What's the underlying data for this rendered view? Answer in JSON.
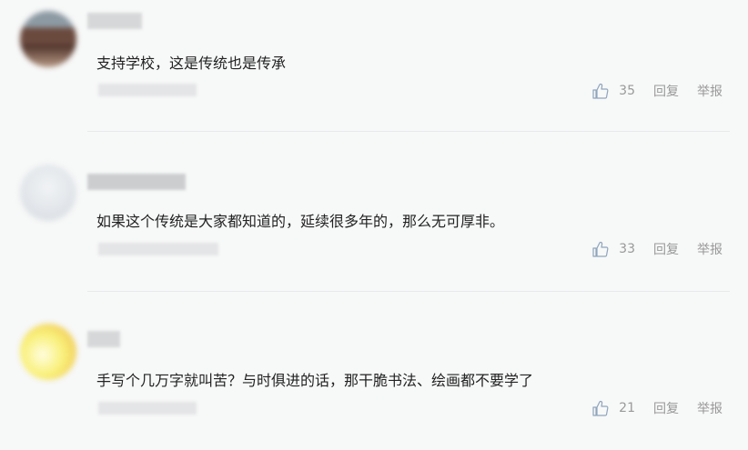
{
  "comments": [
    {
      "text": "支持学校，这是传统也是传承",
      "likes": "35",
      "reply_label": "回复",
      "report_label": "举报"
    },
    {
      "text": "如果这个传统是大家都知道的，延续很多年的，那么无可厚非。",
      "likes": "33",
      "reply_label": "回复",
      "report_label": "举报"
    },
    {
      "text": "手写个几万字就叫苦？与时俱进的话，那干脆书法、绘画都不要学了",
      "likes": "21",
      "reply_label": "回复",
      "report_label": "举报"
    }
  ],
  "icons": {
    "like": "thumbs-up-icon"
  },
  "colors": {
    "background": "#f7f8f8",
    "text": "#222222",
    "meta": "#999999",
    "like_icon": "#8fa4bd"
  }
}
